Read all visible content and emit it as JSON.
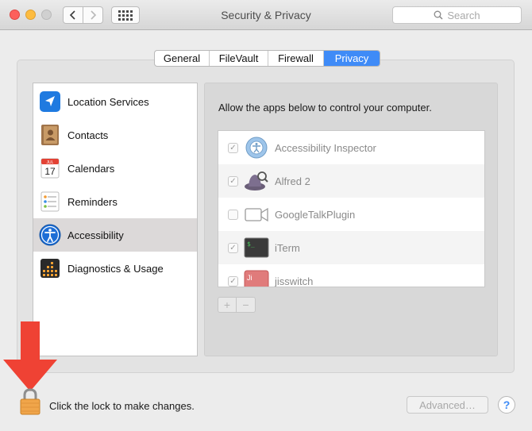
{
  "window": {
    "title": "Security & Privacy",
    "search_placeholder": "Search"
  },
  "tabs": [
    {
      "label": "General",
      "selected": false
    },
    {
      "label": "FileVault",
      "selected": false
    },
    {
      "label": "Firewall",
      "selected": false
    },
    {
      "label": "Privacy",
      "selected": true
    }
  ],
  "sidebar": {
    "items": [
      {
        "label": "Location Services",
        "icon": "location-arrow-icon",
        "selected": false
      },
      {
        "label": "Contacts",
        "icon": "contacts-book-icon",
        "selected": false
      },
      {
        "label": "Calendars",
        "icon": "calendar-icon",
        "selected": false
      },
      {
        "label": "Reminders",
        "icon": "reminders-list-icon",
        "selected": false
      },
      {
        "label": "Accessibility",
        "icon": "accessibility-person-icon",
        "selected": true
      },
      {
        "label": "Diagnostics & Usage",
        "icon": "diagnostics-grid-icon",
        "selected": false
      }
    ]
  },
  "calendar_icon": {
    "month": "JUL",
    "day": "17"
  },
  "privacy": {
    "prompt": "Allow the apps below to control your computer.",
    "apps": [
      {
        "name": "Accessibility Inspector",
        "checked": true,
        "icon": "accessibility-inspector-icon"
      },
      {
        "name": "Alfred 2",
        "checked": true,
        "icon": "alfred-hat-icon"
      },
      {
        "name": "GoogleTalkPlugin",
        "checked": false,
        "icon": "video-camera-icon"
      },
      {
        "name": "iTerm",
        "checked": true,
        "icon": "terminal-icon"
      },
      {
        "name": "jisswitch",
        "checked": true,
        "icon": "jisswitch-icon"
      }
    ],
    "add_label": "+",
    "remove_label": "−"
  },
  "footer": {
    "lock_text": "Click the lock to make changes.",
    "advanced_label": "Advanced…",
    "help_label": "?"
  },
  "colors": {
    "accent": "#3f8bf7",
    "arrow_red": "#ef4234",
    "lock_orange": "#f0a54a"
  }
}
